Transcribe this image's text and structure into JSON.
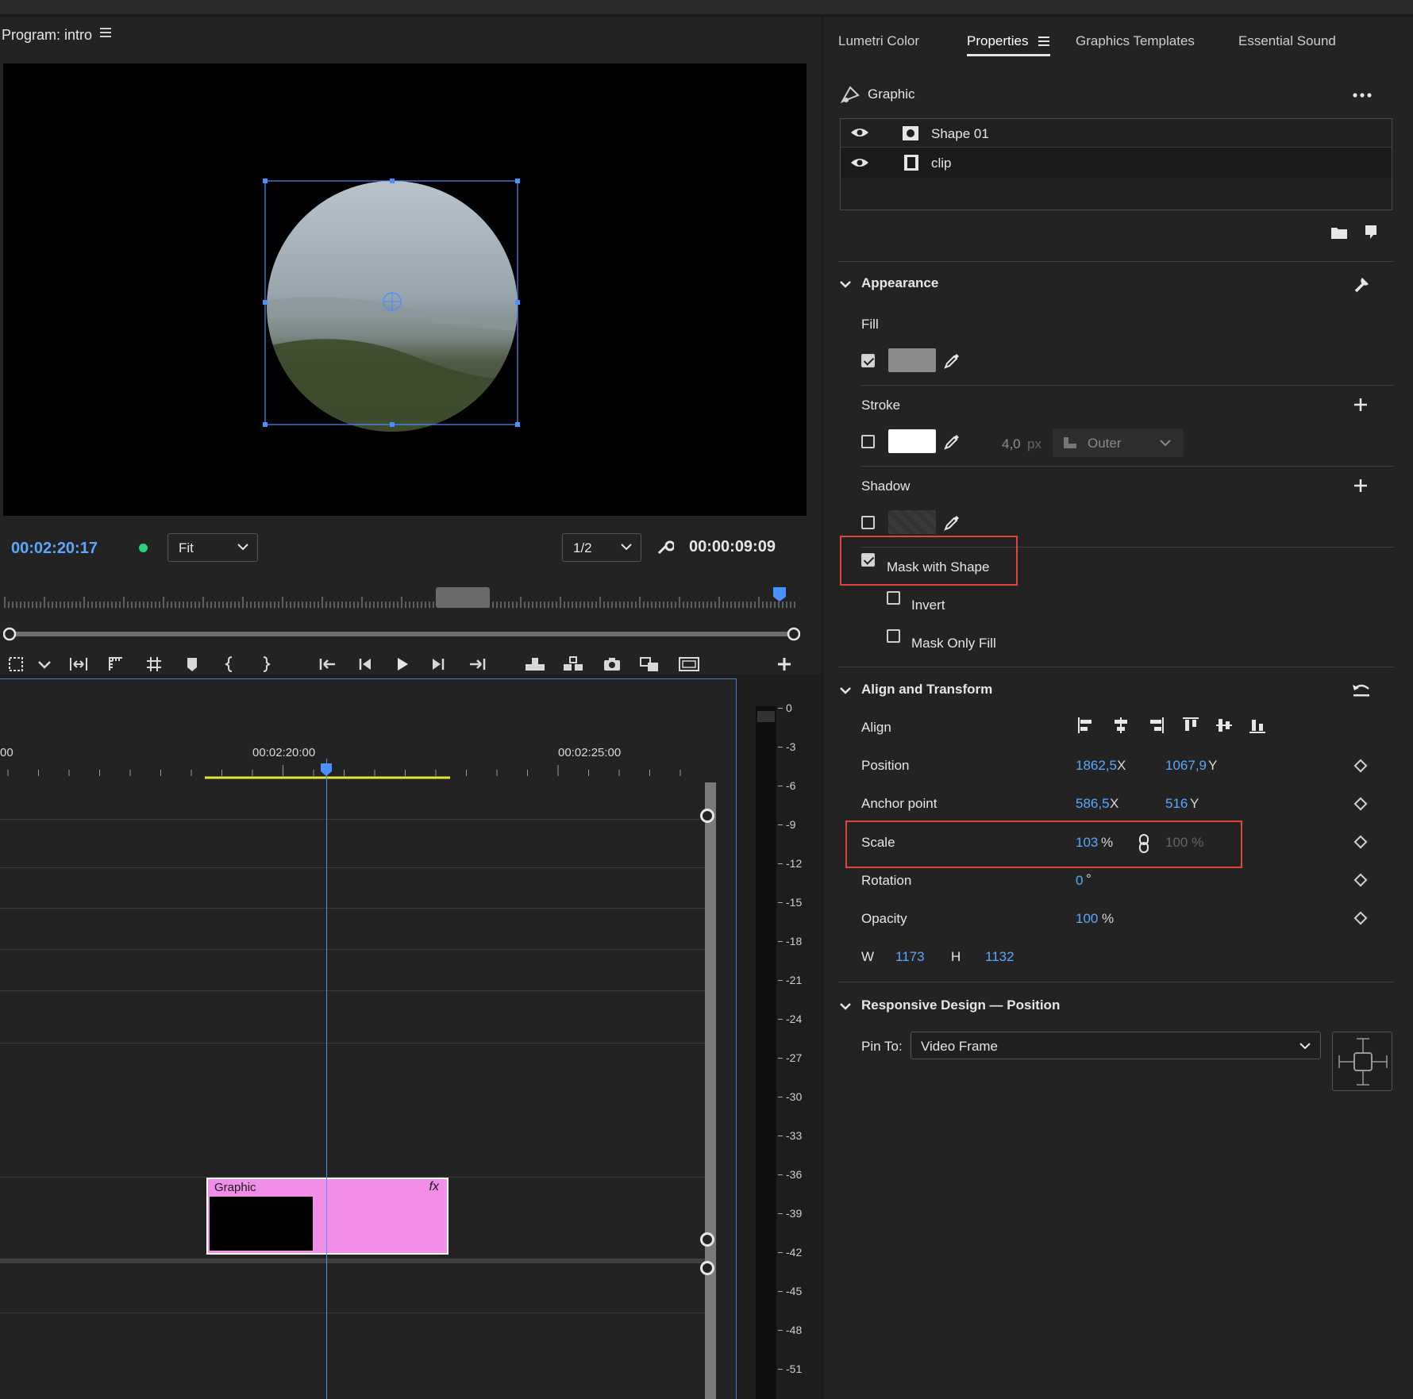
{
  "program": {
    "title": "Program: intro",
    "timecode_current": "00:02:20:17",
    "fit": "Fit",
    "resolution": "1/2",
    "timecode_duration": "00:00:09:09"
  },
  "timeline": {
    "ruler_labels": [
      "00",
      "00:02:20:00",
      "00:02:25:00"
    ],
    "clip_label": "Graphic",
    "clip_fx": "fx"
  },
  "meter": {
    "labels": [
      "0",
      "-3",
      "-6",
      "-9",
      "-12",
      "-15",
      "-18",
      "-21",
      "-24",
      "-27",
      "-30",
      "-33",
      "-36",
      "-39",
      "-42",
      "-45",
      "-48",
      "-51"
    ]
  },
  "tabs": [
    {
      "label": "Lumetri Color"
    },
    {
      "label": "Properties"
    },
    {
      "label": "Graphics Templates"
    },
    {
      "label": "Essential Sound"
    }
  ],
  "graphic": {
    "title": "Graphic",
    "layers": [
      {
        "name": "Shape 01",
        "icon": "shape-layer-icon"
      },
      {
        "name": "clip",
        "icon": "clip-layer-icon"
      }
    ]
  },
  "appearance": {
    "title": "Appearance",
    "fill_label": "Fill",
    "fill_checked": true,
    "fill_color": "#8c8c8c",
    "stroke_label": "Stroke",
    "stroke_checked": false,
    "stroke_color": "#ffffff",
    "stroke_width": "4,0",
    "stroke_unit": "px",
    "stroke_type": "Outer",
    "shadow_label": "Shadow",
    "shadow_checked": false,
    "mask_with_shape": "Mask with Shape",
    "mask_checked": true,
    "invert": "Invert",
    "mask_only_fill": "Mask Only Fill"
  },
  "transform": {
    "title": "Align and Transform",
    "align_label": "Align",
    "position_label": "Position",
    "position_x": "1862,5",
    "position_y": "1067,9",
    "x_suffix": "X",
    "y_suffix": "Y",
    "anchor_label": "Anchor point",
    "anchor_x": "586,5",
    "anchor_y": "516",
    "scale_label": "Scale",
    "scale_value": "103",
    "scale_unit": "%",
    "scale_secondary": "100 %",
    "rotation_label": "Rotation",
    "rotation_value": "0",
    "rotation_unit": "°",
    "opacity_label": "Opacity",
    "opacity_value": "100",
    "opacity_unit": "%",
    "w_label": "W",
    "w_value": "1173",
    "h_label": "H",
    "h_value": "1132"
  },
  "responsive": {
    "title": "Responsive Design — Position",
    "pin_label": "Pin To:",
    "pin_value": "Video Frame"
  },
  "colors": {
    "accent_blue": "#5aa7ff",
    "highlight_red": "#e0453d",
    "clip_pink": "#f08ee8",
    "timecode_green": "#2bd17b"
  }
}
